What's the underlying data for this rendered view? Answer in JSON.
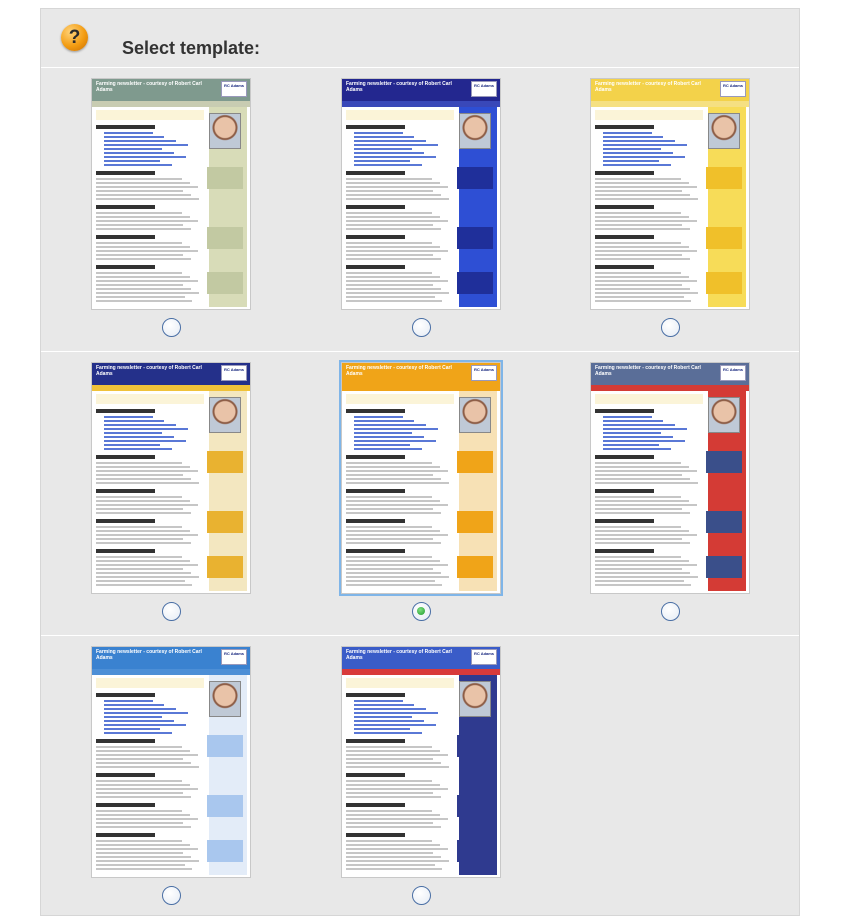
{
  "header": {
    "help_icon_label": "?",
    "title": "Select template:"
  },
  "templates": [
    {
      "banner_text": "Farming newsletter - courtesy of Robert Carl Adams",
      "logo_text": "RC Adams",
      "banner_color": "#7f9a8e",
      "strip_color": "#c8ccb2",
      "side_color": "#d8dcb8",
      "box_color": "#c2c9a2",
      "selected": false
    },
    {
      "banner_text": "Farming newsletter - courtesy of Robert Carl Adams",
      "logo_text": "RC Adams",
      "banner_color": "#23278f",
      "strip_color": "#3948b9",
      "side_color": "#2e4fd4",
      "box_color": "#1f2f9a",
      "selected": false
    },
    {
      "banner_text": "Farming newsletter - courtesy of Robert Carl Adams",
      "logo_text": "RC Adams",
      "banner_color": "#f3d24a",
      "strip_color": "#f5e082",
      "side_color": "#f7dc58",
      "box_color": "#f0c02a",
      "selected": false
    },
    {
      "banner_text": "Farming newsletter - courtesy of Robert Carl Adams",
      "logo_text": "RC Adams",
      "banner_color": "#24308a",
      "strip_color": "#f0c23a",
      "side_color": "#f3e7c0",
      "box_color": "#e9b230",
      "selected": false
    },
    {
      "banner_text": "Farming newsletter - courtesy of Robert Carl Adams",
      "logo_text": "RC Adams",
      "banner_color": "#f0a418",
      "strip_color": "#f0a418",
      "side_color": "#f7e1b5",
      "box_color": "#f0a418",
      "selected": true
    },
    {
      "banner_text": "Farming newsletter - courtesy of Robert Carl Adams",
      "logo_text": "RC Adams",
      "banner_color": "#5a6e98",
      "strip_color": "#d43b35",
      "side_color": "#d43b35",
      "box_color": "#3a4f8a",
      "selected": false
    },
    {
      "banner_text": "Farming newsletter - courtesy of Robert Carl Adams",
      "logo_text": "RC Adams",
      "banner_color": "#3a82d0",
      "strip_color": "#4d8fd6",
      "side_color": "#e3ecf8",
      "box_color": "#a9c7ee",
      "selected": false
    },
    {
      "banner_text": "Farming newsletter - courtesy of Robert Carl Adams",
      "logo_text": "RC Adams",
      "banner_color": "#3a5cc8",
      "strip_color": "#d83a3a",
      "side_color": "#2f3a8f",
      "box_color": "#2f3a8f",
      "selected": false
    }
  ]
}
